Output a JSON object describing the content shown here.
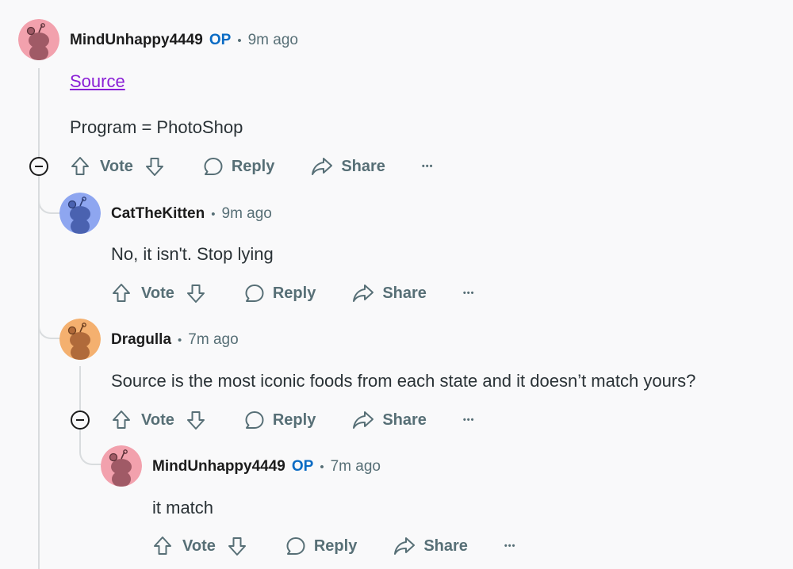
{
  "colors": {
    "avatar_pink": "#f2a1ad",
    "avatar_blue": "#8ea6f0",
    "avatar_orange": "#f4b06f",
    "op_blue": "#0a6bc4",
    "link_purple": "#8a1fd6",
    "meta_gray": "#576f76"
  },
  "comments": [
    {
      "author": "MindUnhappy4449",
      "op_badge": "OP",
      "separator": "•",
      "time": "9m ago",
      "link_text": "Source",
      "text": "Program = PhotoShop",
      "actions": {
        "vote": "Vote",
        "reply": "Reply",
        "share": "Share",
        "more": "•••"
      }
    },
    {
      "author": "CatTheKitten",
      "separator": "•",
      "time": "9m ago",
      "text": "No, it isn't. Stop lying",
      "actions": {
        "vote": "Vote",
        "reply": "Reply",
        "share": "Share",
        "more": "•••"
      }
    },
    {
      "author": "Dragulla",
      "separator": "•",
      "time": "7m ago",
      "text": "Source is the most iconic foods from each state and it doesn’t match yours?",
      "actions": {
        "vote": "Vote",
        "reply": "Reply",
        "share": "Share",
        "more": "•••"
      }
    },
    {
      "author": "MindUnhappy4449",
      "op_badge": "OP",
      "separator": "•",
      "time": "7m ago",
      "text": "it match",
      "actions": {
        "vote": "Vote",
        "reply": "Reply",
        "share": "Share",
        "more": "•••"
      }
    }
  ]
}
